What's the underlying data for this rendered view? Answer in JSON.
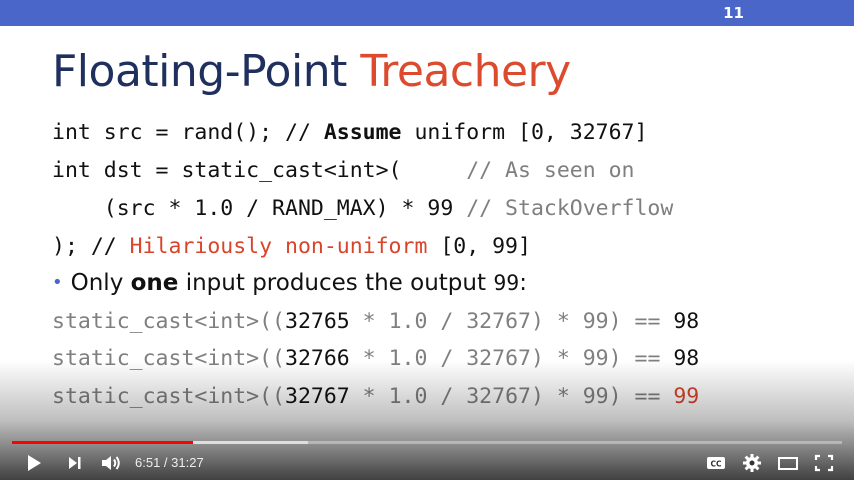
{
  "slide": {
    "number": "11",
    "title_main": "Floating-Point",
    "title_accent": "Treachery",
    "code_lines": [
      {
        "a": "int src = rand(); // ",
        "b": "Assume",
        "c": " uniform [0, 32767]"
      },
      {
        "a": "int dst = static_cast<int>(     ",
        "cmt": "// As seen on"
      },
      {
        "a": "    (src * 1.0 / RAND_MAX) * 99 ",
        "cmt": "// StackOverflow"
      },
      {
        "a": "); // ",
        "red": "Hilariously non-uniform",
        "c": " [0, 99]"
      }
    ],
    "bullet": {
      "pre": "Only ",
      "bold": "one",
      "mid": " input produces the output ",
      "value": "99",
      "post": ":"
    },
    "examples": [
      {
        "prefix": "static_cast<int>((",
        "input": "32765",
        "mid": " * 1.0 / 32767) * 99) == ",
        "result": "98",
        "highlight": false
      },
      {
        "prefix": "static_cast<int>((",
        "input": "32766",
        "mid": " * 1.0 / 32767) * 99) == ",
        "result": "98",
        "highlight": false
      },
      {
        "prefix": "static_cast<int>((",
        "input": "32767",
        "mid": " * 1.0 / 32767) * 99) == ",
        "result": "99",
        "highlight": true
      }
    ]
  },
  "player": {
    "current_time": "6:51",
    "separator": " / ",
    "duration": "31:27",
    "progress_fraction": 0.218,
    "buffered_fraction": 0.357,
    "colors": {
      "played": "#ff0000",
      "accent_bar": "#4a66c8"
    },
    "icons": [
      "play-icon",
      "next-icon",
      "volume-icon",
      "captions-icon",
      "settings-icon",
      "theater-icon",
      "fullscreen-icon"
    ]
  }
}
